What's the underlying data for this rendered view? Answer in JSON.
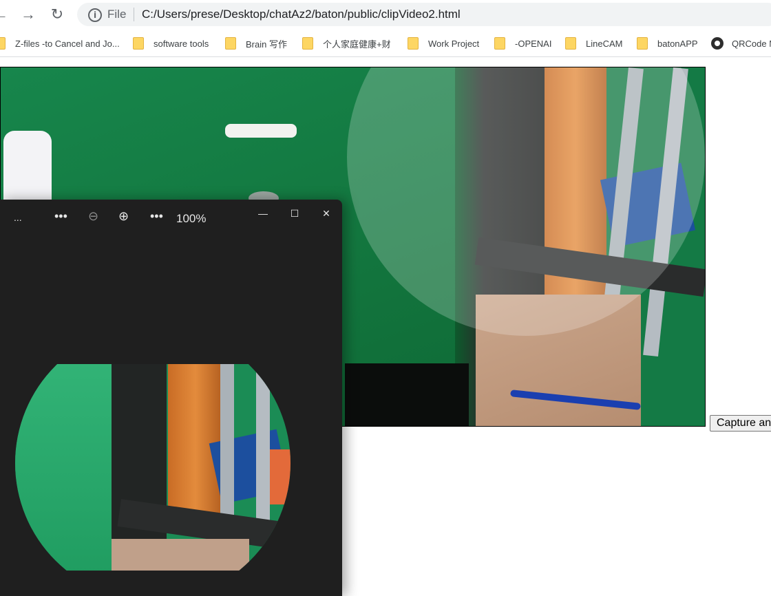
{
  "browser": {
    "scheme_label": "File",
    "url": "C:/Users/prese/Desktop/chatAz2/baton/public/clipVideo2.html"
  },
  "bookmarks": [
    {
      "label": "Z-files -to Cancel and Jo...",
      "icon": "folder-icon"
    },
    {
      "label": "software tools",
      "icon": "folder-icon"
    },
    {
      "label": "Brain 写作",
      "icon": "folder-icon"
    },
    {
      "label": "个人家庭健康+财",
      "icon": "folder-icon"
    },
    {
      "label": "Work Project",
      "icon": "folder-icon"
    },
    {
      "label": "-OPENAI",
      "icon": "folder-icon"
    },
    {
      "label": "LineCAM",
      "icon": "folder-icon"
    },
    {
      "label": "batonAPP",
      "icon": "folder-icon"
    },
    {
      "label": "QRCode M",
      "icon": "qr-icon"
    }
  ],
  "page": {
    "capture_button": "Capture an"
  },
  "viewer": {
    "menu_ellipsis": "...",
    "zoom_level": "100%"
  },
  "colors": {
    "viewer_bg": "#1f1f1f",
    "omnibox_bg": "#f1f3f4",
    "folder": "#fdd663"
  }
}
